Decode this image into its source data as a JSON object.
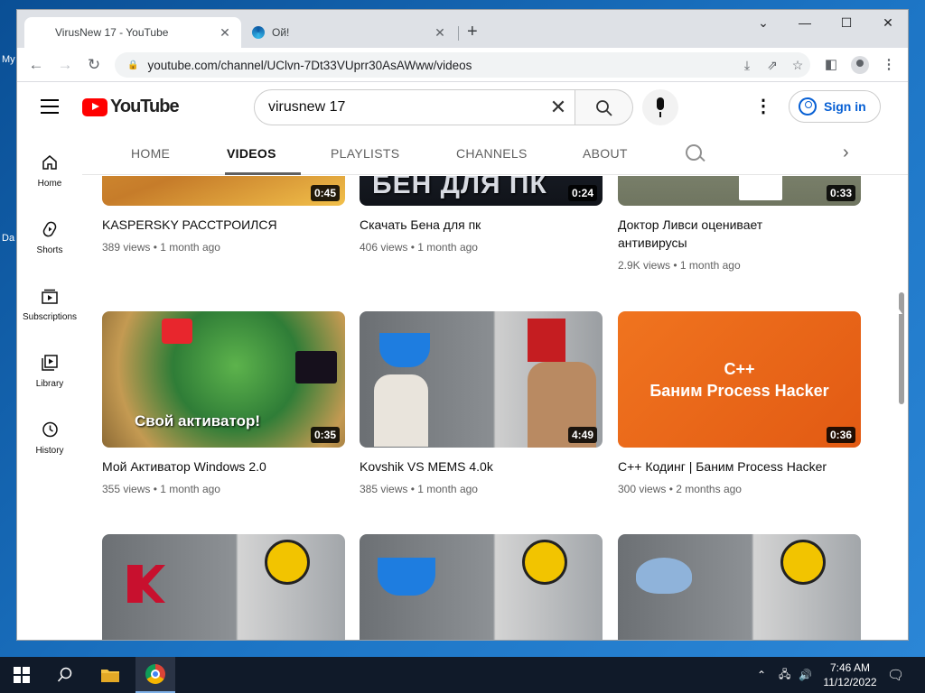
{
  "desktop": {
    "icon_label_1": "My",
    "icon_label_2": "Da"
  },
  "browser": {
    "tabs": [
      {
        "title": "VirusNew 17 - YouTube",
        "favicon": "youtube-favicon"
      },
      {
        "title": "Ой!",
        "favicon": "edge-favicon"
      }
    ],
    "new_tab": "+",
    "url": "youtube.com/channel/UClvn-7Dt33VUprr30AsAWww/videos"
  },
  "youtube": {
    "logo_text": "YouTube",
    "search_value": "virusnew 17",
    "sign_in": "Sign in",
    "guide": [
      {
        "label": "Home",
        "icon": "home-icon"
      },
      {
        "label": "Shorts",
        "icon": "shorts-icon"
      },
      {
        "label": "Subscriptions",
        "icon": "subscriptions-icon"
      },
      {
        "label": "Library",
        "icon": "library-icon"
      },
      {
        "label": "History",
        "icon": "history-icon"
      }
    ],
    "channel_tabs": [
      "HOME",
      "VIDEOS",
      "PLAYLISTS",
      "CHANNELS",
      "ABOUT"
    ],
    "selected_tab": "VIDEOS",
    "videos": [
      {
        "title": "KASPERSKY РАССТРОИЛСЯ",
        "duration": "0:45",
        "views": "389 views",
        "age": "1 month ago"
      },
      {
        "title": "Скачать Бена для пк",
        "duration": "0:24",
        "views": "406 views",
        "age": "1 month ago",
        "thumb_text": "БЕН ДЛЯ ПК"
      },
      {
        "title": "Доктор Ливси оценивает антивирусы",
        "duration": "0:33",
        "views": "2.9K views",
        "age": "1 month ago"
      },
      {
        "title": "Мой Активатор Windows 2.0",
        "duration": "0:35",
        "views": "355 views",
        "age": "1 month ago",
        "thumb_text": "Свой активатор!"
      },
      {
        "title": "Kovshik VS MEMS 4.0k",
        "duration": "4:49",
        "views": "385 views",
        "age": "1 month ago"
      },
      {
        "title": "С++ Кодинг | Баним Process Hacker",
        "duration": "0:36",
        "views": "300 views",
        "age": "2 months ago",
        "thumb_text_1": "С++",
        "thumb_text_2": "Баним Process Hacker"
      }
    ]
  },
  "taskbar": {
    "time": "7:46 AM",
    "date": "11/12/2022"
  },
  "colors": {
    "youtube_red": "#ff0000",
    "link_blue": "#065fd4",
    "taskbar": "#101a29",
    "desktop": "#1c74c4"
  }
}
